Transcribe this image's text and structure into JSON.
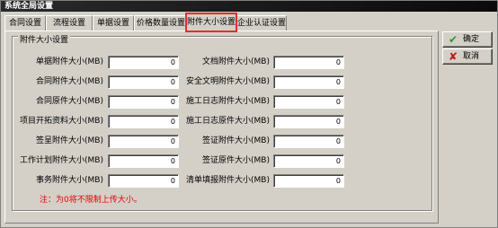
{
  "window": {
    "title": "系统全局设置"
  },
  "tabs": [
    {
      "label": "合同设置"
    },
    {
      "label": "流程设置"
    },
    {
      "label": "单据设置"
    },
    {
      "label": "价格数量设置"
    },
    {
      "label": "附件大小设置",
      "active": true
    },
    {
      "label": "企业认证设置"
    }
  ],
  "group": {
    "title": "附件大小设置"
  },
  "fields_left": [
    {
      "label": "单据附件大小(MB)",
      "value": "0"
    },
    {
      "label": "合同附件大小(MB)",
      "value": "0"
    },
    {
      "label": "合同原件大小(MB)",
      "value": "0"
    },
    {
      "label": "项目开拓资料大小(MB)",
      "value": "0"
    },
    {
      "label": "签呈附件大小(MB)",
      "value": "0"
    },
    {
      "label": "工作计划附件大小(MB)",
      "value": "0"
    },
    {
      "label": "事务附件大小(MB)",
      "value": "0"
    }
  ],
  "fields_right": [
    {
      "label": "文档附件大小(MB)",
      "value": "0"
    },
    {
      "label": "安全文明附件大小(MB)",
      "value": "0"
    },
    {
      "label": "施工日志附件大小(MB)",
      "value": "0"
    },
    {
      "label": "施工日志原件大小(MB)",
      "value": "0"
    },
    {
      "label": "签证附件大小(MB)",
      "value": "0"
    },
    {
      "label": "签证原件大小(MB)",
      "value": "0"
    },
    {
      "label": "清单填报附件大小(MB)",
      "value": "0"
    }
  ],
  "note": "注：为0将不限制上传大小。",
  "buttons": {
    "ok": {
      "label": "确定",
      "icon": "check-icon",
      "color": "#2a9a2a"
    },
    "cancel": {
      "label": "取消",
      "icon": "x-icon",
      "color": "#c01818"
    }
  }
}
